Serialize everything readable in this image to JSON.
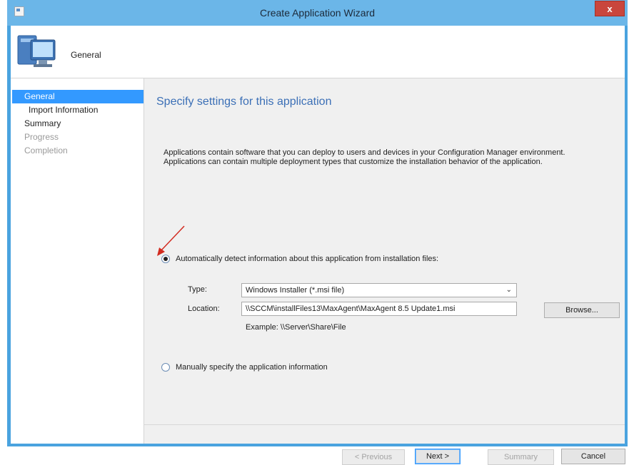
{
  "window": {
    "title": "Create Application Wizard",
    "close_label": "x"
  },
  "header": {
    "title": "General"
  },
  "nav": {
    "items": [
      {
        "label": "General"
      },
      {
        "label": "Import Information"
      },
      {
        "label": "Summary"
      },
      {
        "label": "Progress"
      },
      {
        "label": "Completion"
      }
    ]
  },
  "content": {
    "title": "Specify settings for this application",
    "description_line1": "Applications contain software that you can deploy to users and devices in your Configuration Manager environment.",
    "description_line2": "Applications can contain multiple deployment types that customize the installation behavior of the application.",
    "auto_detect_label": "Automatically detect information about this application from installation files:",
    "type_label": "Type:",
    "type_value": "Windows Installer (*.msi file)",
    "location_label": "Location:",
    "location_value": "\\\\SCCM\\installFiles13\\MaxAgent\\MaxAgent 8.5 Update1.msi",
    "example_text": "Example: \\\\Server\\Share\\File",
    "browse_label": "Browse...",
    "manual_label": "Manually specify the application information"
  },
  "footer": {
    "previous_label": "< Previous",
    "next_label": "Next >",
    "summary_label": "Summary",
    "cancel_label": "Cancel"
  },
  "colors": {
    "accent": "#3399ff",
    "title_text": "#3b6fb6",
    "annotation_arrow": "#d22b20"
  }
}
